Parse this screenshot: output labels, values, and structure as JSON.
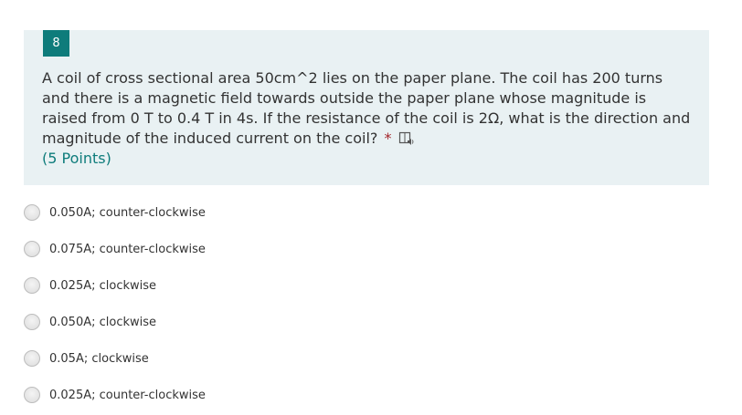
{
  "question": {
    "number": "8",
    "text": "A coil of cross sectional area 50cm^2 lies on the paper plane. The coil has 200 turns and there is a magnetic field towards outside the paper plane whose magnitude is raised from 0 T to 0.4 T in 4s. If the resistance of the coil is 2Ω, what is the direction and magnitude of the induced current on the coil?",
    "required_marker": "*",
    "points": "(5 Points)",
    "reader_icon": "immersive-reader-icon"
  },
  "options": [
    {
      "label": "0.050A; counter-clockwise",
      "selected": false
    },
    {
      "label": "0.075A; counter-clockwise",
      "selected": false
    },
    {
      "label": "0.025A; clockwise",
      "selected": false
    },
    {
      "label": "0.050A; clockwise",
      "selected": false
    },
    {
      "label": "0.05A; clockwise",
      "selected": false
    },
    {
      "label": "0.025A; counter-clockwise",
      "selected": false
    }
  ],
  "colors": {
    "accent": "#0e7c7b",
    "card_background": "#e9f1f3",
    "required": "#a4262c",
    "text": "#333333"
  }
}
